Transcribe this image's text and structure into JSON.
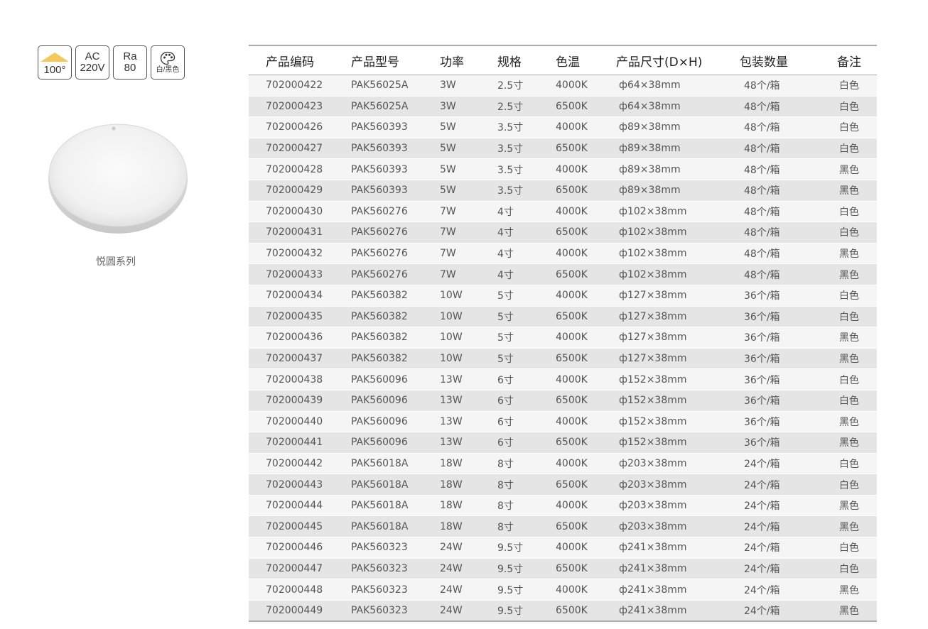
{
  "badges": {
    "beam_angle": "100°",
    "voltage_top": "AC",
    "voltage_bottom": "220V",
    "cri_top": "Ra",
    "cri_bottom": "80",
    "color_label": "白/黑色"
  },
  "product": {
    "name": "悦圆系列",
    "image": "round-white-downlight"
  },
  "colors": {
    "beam_accent": "#f5c85b",
    "row_odd": "#f5f5f5",
    "row_even": "#e5e5e5"
  },
  "table": {
    "headers": [
      "产品编码",
      "产品型号",
      "功率",
      "规格",
      "色温",
      "产品尺寸(D×H)",
      "包装数量",
      "备注"
    ],
    "rows": [
      [
        "702000422",
        "PAK56025A",
        "3W",
        "2.5寸",
        "4000K",
        "ф64×38mm",
        "48个/箱",
        "白色"
      ],
      [
        "702000423",
        "PAK56025A",
        "3W",
        "2.5寸",
        "6500K",
        "ф64×38mm",
        "48个/箱",
        "白色"
      ],
      [
        "702000426",
        "PAK560393",
        "5W",
        "3.5寸",
        "4000K",
        "ф89×38mm",
        "48个/箱",
        "白色"
      ],
      [
        "702000427",
        "PAK560393",
        "5W",
        "3.5寸",
        "6500K",
        "ф89×38mm",
        "48个/箱",
        "白色"
      ],
      [
        "702000428",
        "PAK560393",
        "5W",
        "3.5寸",
        "4000K",
        "ф89×38mm",
        "48个/箱",
        "黑色"
      ],
      [
        "702000429",
        "PAK560393",
        "5W",
        "3.5寸",
        "6500K",
        "ф89×38mm",
        "48个/箱",
        "黑色"
      ],
      [
        "702000430",
        "PAK560276",
        "7W",
        "4寸",
        "4000K",
        "ф102×38mm",
        "48个/箱",
        "白色"
      ],
      [
        "702000431",
        "PAK560276",
        "7W",
        "4寸",
        "6500K",
        "ф102×38mm",
        "48个/箱",
        "白色"
      ],
      [
        "702000432",
        "PAK560276",
        "7W",
        "4寸",
        "4000K",
        "ф102×38mm",
        "48个/箱",
        "黑色"
      ],
      [
        "702000433",
        "PAK560276",
        "7W",
        "4寸",
        "6500K",
        "ф102×38mm",
        "48个/箱",
        "黑色"
      ],
      [
        "702000434",
        "PAK560382",
        "10W",
        "5寸",
        "4000K",
        "ф127×38mm",
        "36个/箱",
        "白色"
      ],
      [
        "702000435",
        "PAK560382",
        "10W",
        "5寸",
        "6500K",
        "ф127×38mm",
        "36个/箱",
        "白色"
      ],
      [
        "702000436",
        "PAK560382",
        "10W",
        "5寸",
        "4000K",
        "ф127×38mm",
        "36个/箱",
        "黑色"
      ],
      [
        "702000437",
        "PAK560382",
        "10W",
        "5寸",
        "6500K",
        "ф127×38mm",
        "36个/箱",
        "黑色"
      ],
      [
        "702000438",
        "PAK560096",
        "13W",
        "6寸",
        "4000K",
        "ф152×38mm",
        "36个/箱",
        "白色"
      ],
      [
        "702000439",
        "PAK560096",
        "13W",
        "6寸",
        "6500K",
        "ф152×38mm",
        "36个/箱",
        "白色"
      ],
      [
        "702000440",
        "PAK560096",
        "13W",
        "6寸",
        "4000K",
        "ф152×38mm",
        "36个/箱",
        "黑色"
      ],
      [
        "702000441",
        "PAK560096",
        "13W",
        "6寸",
        "6500K",
        "ф152×38mm",
        "36个/箱",
        "黑色"
      ],
      [
        "702000442",
        "PAK56018A",
        "18W",
        "8寸",
        "4000K",
        "ф203×38mm",
        "24个/箱",
        "白色"
      ],
      [
        "702000443",
        "PAK56018A",
        "18W",
        "8寸",
        "6500K",
        "ф203×38mm",
        "24个/箱",
        "白色"
      ],
      [
        "702000444",
        "PAK56018A",
        "18W",
        "8寸",
        "4000K",
        "ф203×38mm",
        "24个/箱",
        "黑色"
      ],
      [
        "702000445",
        "PAK56018A",
        "18W",
        "8寸",
        "6500K",
        "ф203×38mm",
        "24个/箱",
        "黑色"
      ],
      [
        "702000446",
        "PAK560323",
        "24W",
        "9.5寸",
        "4000K",
        "ф241×38mm",
        "24个/箱",
        "白色"
      ],
      [
        "702000447",
        "PAK560323",
        "24W",
        "9.5寸",
        "6500K",
        "ф241×38mm",
        "24个/箱",
        "白色"
      ],
      [
        "702000448",
        "PAK560323",
        "24W",
        "9.5寸",
        "4000K",
        "ф241×38mm",
        "24个/箱",
        "黑色"
      ],
      [
        "702000449",
        "PAK560323",
        "24W",
        "9.5寸",
        "6500K",
        "ф241×38mm",
        "24个/箱",
        "黑色"
      ]
    ]
  }
}
